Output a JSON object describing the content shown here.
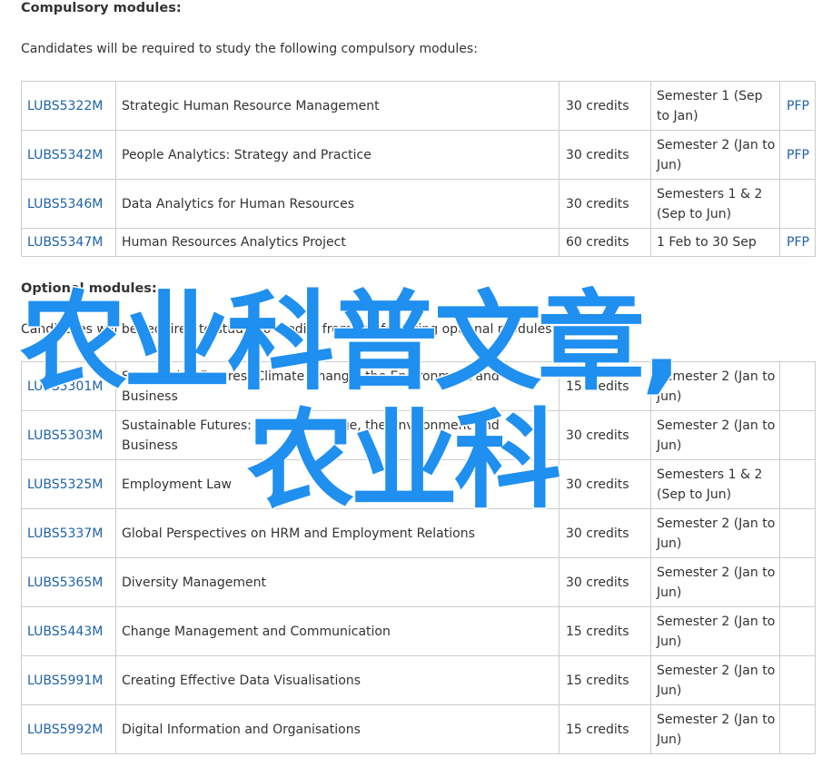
{
  "compulsory": {
    "heading": "Compulsory modules:",
    "intro": "Candidates will be required to study the following compulsory modules:",
    "rows": [
      {
        "code": "LUBS5322M",
        "title": "Strategic Human Resource Management",
        "credits": "30 credits",
        "semester": "Semester 1 (Sep to Jan)",
        "pfp": "PFP"
      },
      {
        "code": "LUBS5342M",
        "title": "People Analytics: Strategy and Practice",
        "credits": "30 credits",
        "semester": "Semester 2 (Jan to Jun)",
        "pfp": "PFP"
      },
      {
        "code": "LUBS5346M",
        "title": "Data Analytics for Human Resources",
        "credits": "30 credits",
        "semester": "Semesters 1 & 2 (Sep to Jun)",
        "pfp": ""
      },
      {
        "code": "LUBS5347M",
        "title": "Human Resources Analytics Project",
        "credits": "60 credits",
        "semester": "1 Feb to 30 Sep",
        "pfp": "PFP"
      }
    ]
  },
  "optional": {
    "heading": "Optional modules:",
    "intro": "Candidates will be required to study 30 credits from the following optional modules:",
    "rows": [
      {
        "code": "LUBS5301M",
        "title": "Sustainable Futures: Climate Change, the Environment and Business",
        "credits": "15 credits",
        "semester": "Semester 2 (Jan to Jun)",
        "pfp": ""
      },
      {
        "code": "LUBS5303M",
        "title": "Sustainable Futures: Climate Change, the Environment and Business",
        "credits": "30 credits",
        "semester": "Semester 2 (Jan to Jun)",
        "pfp": ""
      },
      {
        "code": "LUBS5325M",
        "title": "Employment Law",
        "credits": "30 credits",
        "semester": "Semesters 1 & 2 (Sep to Jun)",
        "pfp": ""
      },
      {
        "code": "LUBS5337M",
        "title": "Global Perspectives on HRM and Employment Relations",
        "credits": "30 credits",
        "semester": "Semester 2 (Jan to Jun)",
        "pfp": ""
      },
      {
        "code": "LUBS5365M",
        "title": "Diversity Management",
        "credits": "30 credits",
        "semester": "Semester 2 (Jan to Jun)",
        "pfp": ""
      },
      {
        "code": "LUBS5443M",
        "title": "Change Management and Communication",
        "credits": "15 credits",
        "semester": "Semester 2 (Jan to Jun)",
        "pfp": ""
      },
      {
        "code": "LUBS5991M",
        "title": "Creating Effective Data Visualisations",
        "credits": "15 credits",
        "semester": "Semester 2 (Jan to Jun)",
        "pfp": ""
      },
      {
        "code": "LUBS5992M",
        "title": "Digital Information and Organisations",
        "credits": "15 credits",
        "semester": "Semester 2 (Jan to Jun)",
        "pfp": ""
      }
    ]
  },
  "watermark": {
    "line1": "农业科普文章,",
    "line2": "农业科",
    "color": "#1f8ff0"
  },
  "colors": {
    "link": "#1f62a8",
    "border": "#cccccc",
    "text": "#333333"
  }
}
